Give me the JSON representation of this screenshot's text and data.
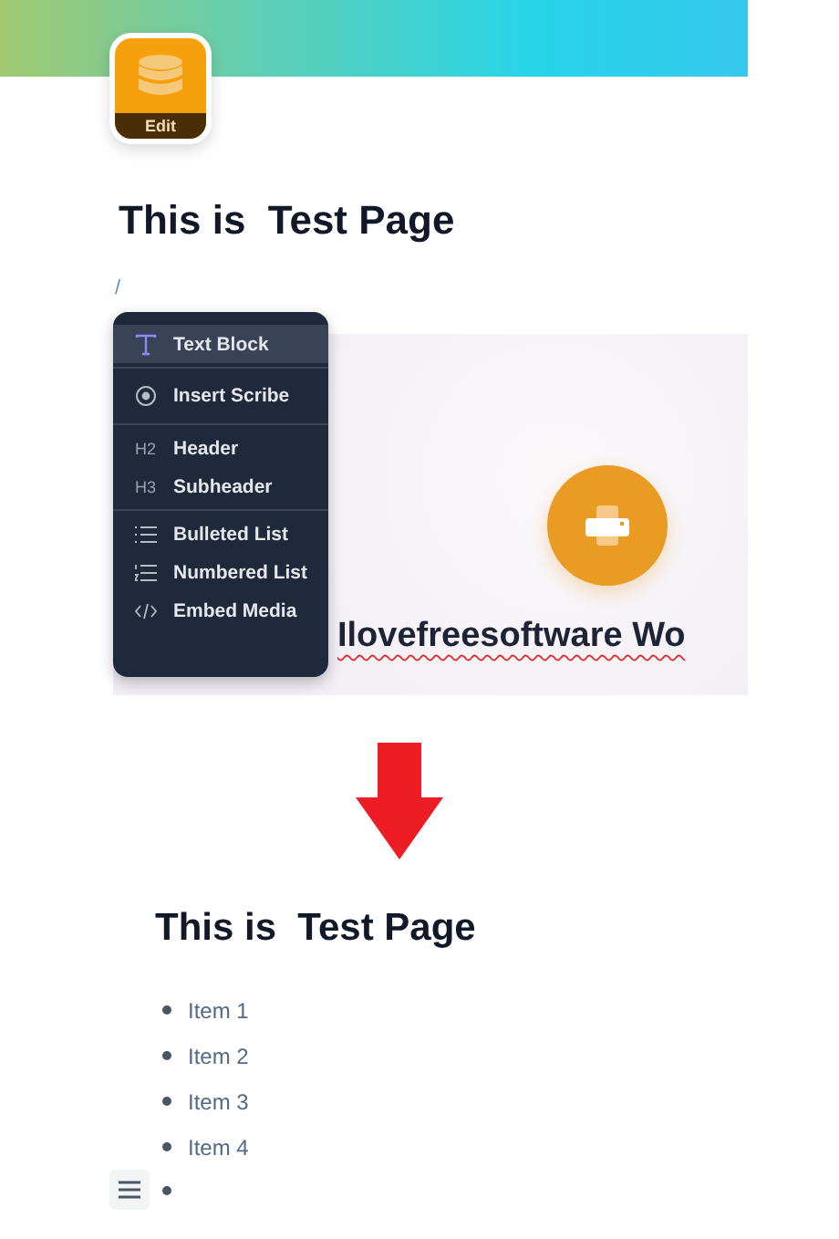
{
  "page_icon": {
    "badge": "Edit"
  },
  "title": "This is  Test Page",
  "slash_input": "/",
  "menu": {
    "groups": [
      {
        "items": [
          {
            "label": "Text Block",
            "kind": "text",
            "selected": true
          }
        ]
      },
      {
        "items": [
          {
            "label": "Insert Scribe",
            "kind": "scribe",
            "selected": false
          }
        ]
      },
      {
        "items": [
          {
            "label": "Header",
            "kind": "heading",
            "icon_text": "H2",
            "selected": false
          },
          {
            "label": "Subheader",
            "kind": "heading",
            "icon_text": "H3",
            "selected": false
          }
        ]
      },
      {
        "items": [
          {
            "label": "Bulleted List",
            "kind": "bullets",
            "selected": false
          },
          {
            "label": "Numbered List",
            "kind": "numbers",
            "selected": false
          },
          {
            "label": "Embed Media",
            "kind": "code",
            "selected": false
          }
        ]
      }
    ]
  },
  "embed": {
    "caption": "Ilovefreesoftware Wo",
    "spellcheck_error": true
  },
  "result": {
    "title": "This is  Test Page",
    "items": [
      "Item 1",
      "Item 2",
      "Item 3",
      "Item 4"
    ],
    "trailing_empty_bullet": true
  }
}
